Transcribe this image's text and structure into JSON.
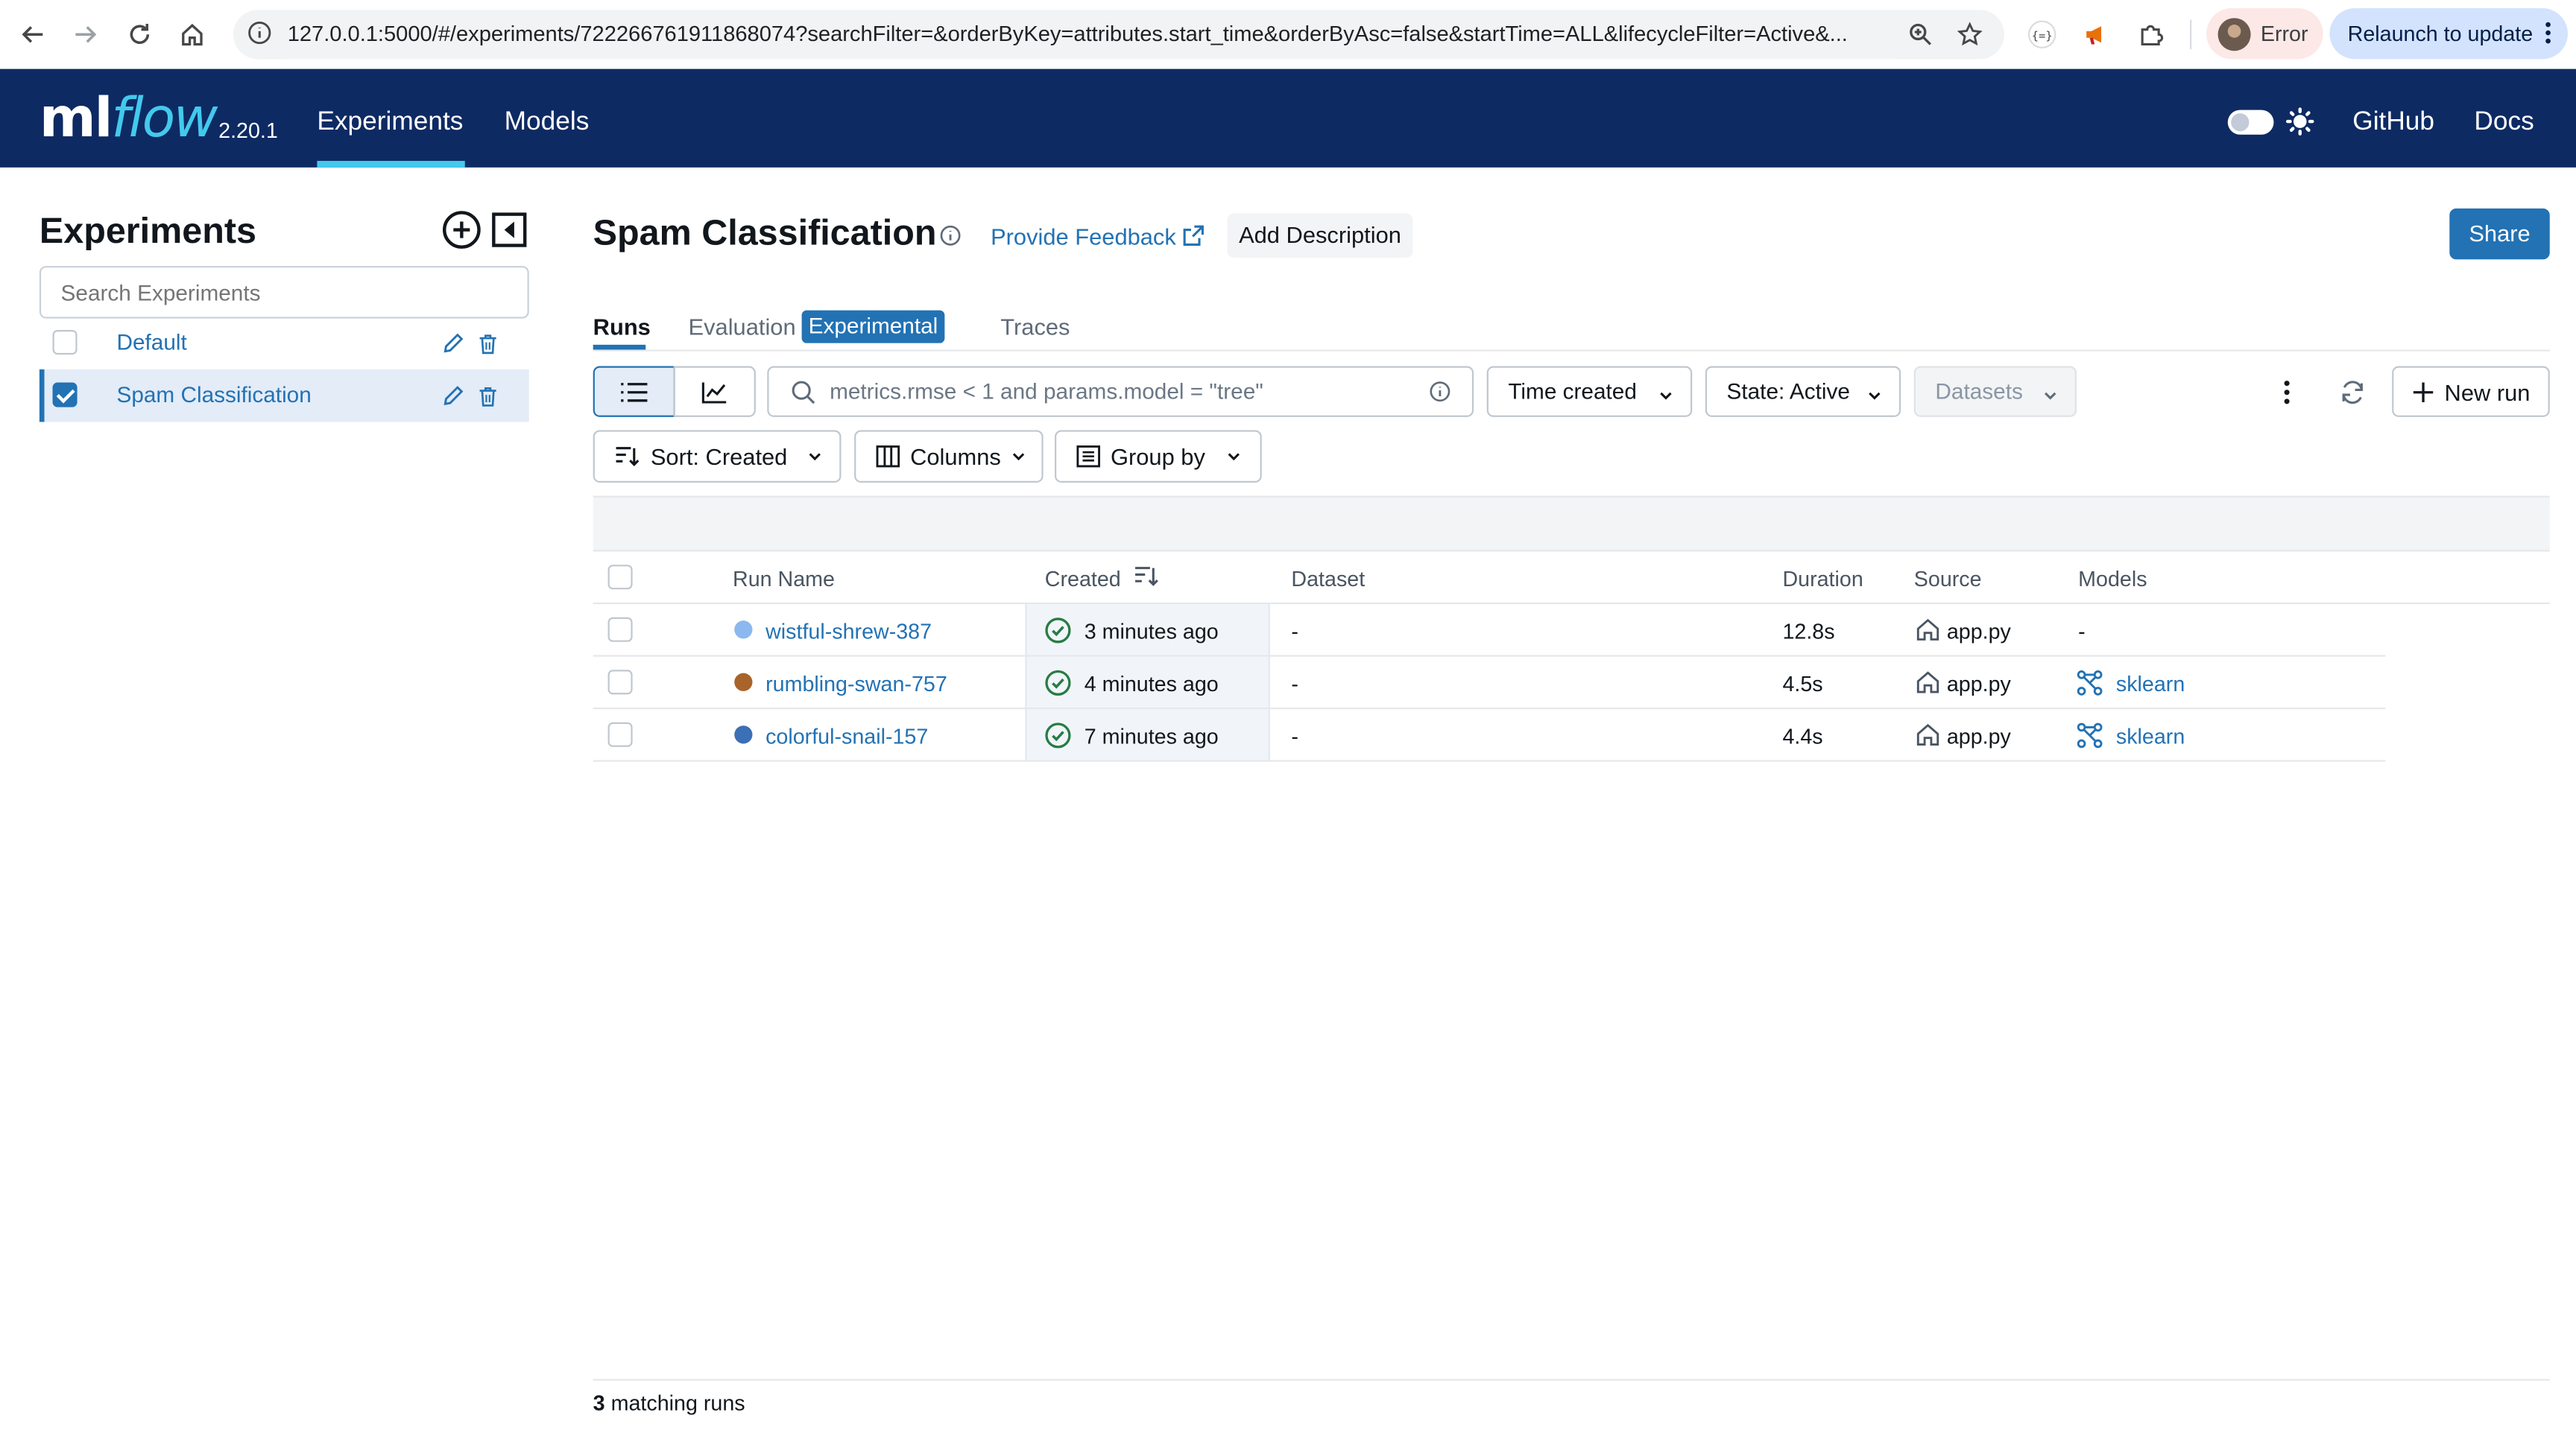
{
  "browser": {
    "url": "127.0.0.1:5000/#/experiments/722266761911868074?searchFilter=&orderByKey=attributes.start_time&orderByAsc=false&startTime=ALL&lifecycleFilter=Active&...",
    "profile_status": "Error",
    "relaunch_label": "Relaunch to update"
  },
  "header": {
    "logo_ml": "ml",
    "logo_flow": "flow",
    "version": "2.20.1",
    "nav": [
      "Experiments",
      "Models"
    ],
    "links": [
      "GitHub",
      "Docs"
    ]
  },
  "sidebar": {
    "title": "Experiments",
    "search_placeholder": "Search Experiments",
    "experiments": [
      {
        "name": "Default",
        "checked": false
      },
      {
        "name": "Spam Classification",
        "checked": true
      }
    ]
  },
  "main": {
    "title": "Spam Classification",
    "feedback_label": "Provide Feedback",
    "add_description_label": "Add Description",
    "share_label": "Share",
    "tabs": {
      "runs": "Runs",
      "evaluation": "Evaluation",
      "experimental_badge": "Experimental",
      "traces": "Traces"
    },
    "filter_placeholder": "metrics.rmse < 1 and params.model = \"tree\"",
    "time_filter": "Time created",
    "state_filter": "State: Active",
    "datasets_filter": "Datasets",
    "new_run_label": "New run",
    "sort_label": "Sort: Created",
    "columns_label": "Columns",
    "group_by_label": "Group by"
  },
  "table": {
    "headers": {
      "run_name": "Run Name",
      "created": "Created",
      "dataset": "Dataset",
      "duration": "Duration",
      "source": "Source",
      "models": "Models"
    },
    "rows": [
      {
        "run_name": "wistful-shrew-387",
        "color": "#8ab8ef",
        "created": "3 minutes ago",
        "dataset": "-",
        "duration": "12.8s",
        "source": "app.py",
        "models": "-",
        "has_model": false
      },
      {
        "run_name": "rumbling-swan-757",
        "color": "#a8642a",
        "created": "4 minutes ago",
        "dataset": "-",
        "duration": "4.5s",
        "source": "app.py",
        "models": "sklearn",
        "has_model": true
      },
      {
        "run_name": "colorful-snail-157",
        "color": "#3b6fb6",
        "created": "7 minutes ago",
        "dataset": "-",
        "duration": "4.4s",
        "source": "app.py",
        "models": "sklearn",
        "has_model": true
      }
    ]
  },
  "footer": {
    "count": "3",
    "label": "matching runs"
  },
  "colors": {
    "brand_navy": "#0e2a63",
    "accent_cyan": "#43c9ed",
    "link_blue": "#2272b4",
    "success_green": "#277c43"
  }
}
